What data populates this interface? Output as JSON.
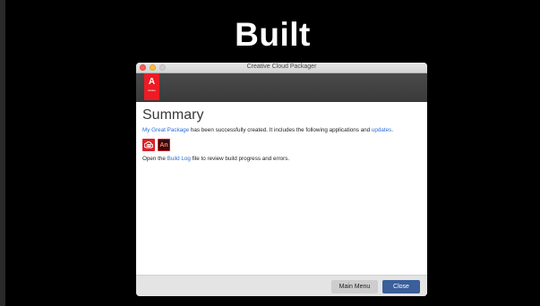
{
  "slide": {
    "title": "Built"
  },
  "window": {
    "title": "Creative Cloud Packager"
  },
  "brand": {
    "logo_mark": "A",
    "logo_word": "Adobe"
  },
  "summary": {
    "heading": "Summary",
    "package_name": "My Great Package",
    "created_text": " has been successfully created. It includes the following applications and ",
    "updates_link": "updates",
    "period": ".",
    "apps": [
      {
        "icon": "creative-cloud-icon",
        "label": ""
      },
      {
        "icon": "animate-icon",
        "label": "An"
      }
    ],
    "log_prefix": "Open the ",
    "build_log_link": "Build Log",
    "log_suffix": " file to review build progress and errors."
  },
  "footer": {
    "main_menu_label": "Main Menu",
    "close_label": "Close"
  },
  "colors": {
    "link": "#2a6fd6",
    "adobe_red": "#ed1c24",
    "primary_button": "#3a5f9a"
  }
}
